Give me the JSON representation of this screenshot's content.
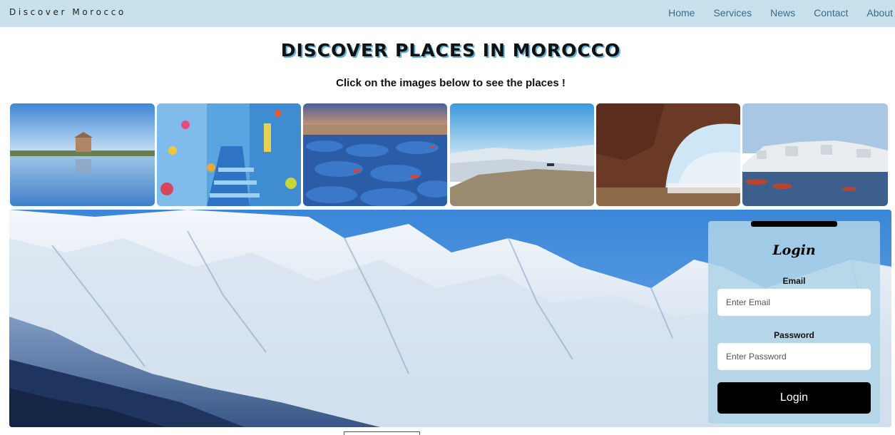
{
  "navbar": {
    "brand": "Discover Morocco",
    "links": [
      "Home",
      "Services",
      "News",
      "Contact",
      "About"
    ]
  },
  "header": {
    "title": "DISCOVER PLACES IN MOROCCO",
    "subtitle": "Click on the images below to see the places !"
  },
  "gallery": {
    "images": [
      "marrakech-pavilion-photo",
      "chefchaouen-blue-street-photo",
      "essaouira-blue-boats-photo",
      "desert-dunes-photo",
      "legzira-arch-beach-photo",
      "coastal-town-harbor-photo"
    ]
  },
  "hero": {
    "image": "snowy-atlas-mountains-photo"
  },
  "login": {
    "title": "Login",
    "email_label": "Email",
    "email_placeholder": "Enter Email",
    "password_label": "Password",
    "password_placeholder": "Enter Password",
    "button_label": "Login"
  }
}
